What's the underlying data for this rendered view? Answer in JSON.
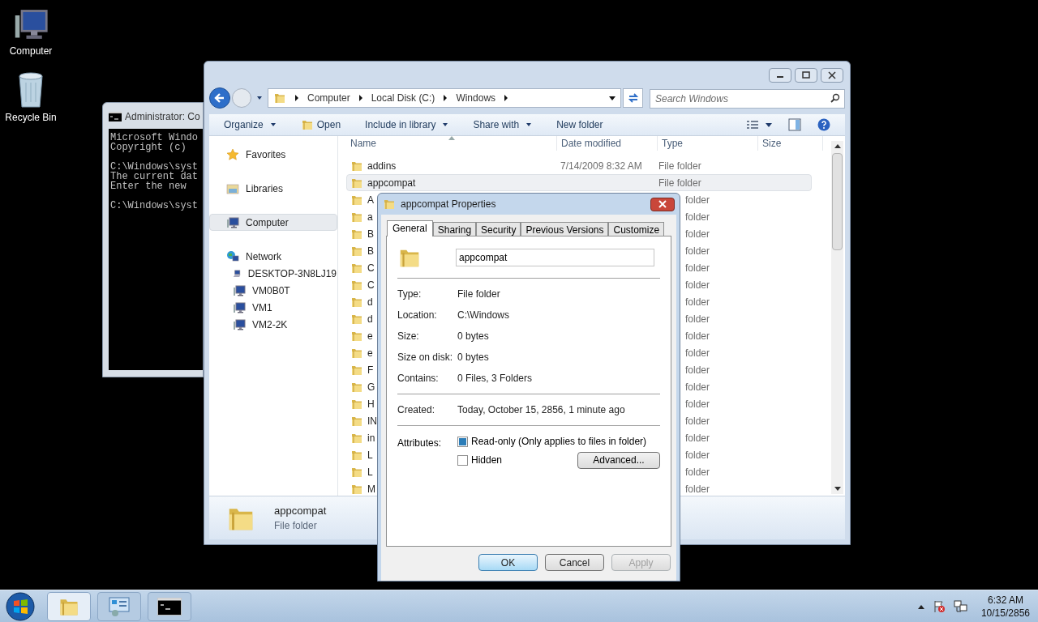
{
  "desktop_icons": [
    {
      "label": "Computer",
      "kind": "computer"
    },
    {
      "label": "Recycle Bin",
      "kind": "recycle"
    }
  ],
  "console": {
    "title": "Administrator: Co",
    "blocks": [
      [
        "Microsoft Windo",
        "Copyright (c)"
      ],
      [
        "C:\\Windows\\syst",
        "The current dat",
        "Enter the new"
      ],
      [
        "C:\\Windows\\syst"
      ]
    ]
  },
  "explorer": {
    "breadcrumbs": [
      "Computer",
      "Local Disk (C:)",
      "Windows"
    ],
    "search": {
      "placeholder": "Search Windows"
    },
    "toolbar": [
      {
        "label": "Organize",
        "kind": "menu"
      },
      {
        "label": "Open",
        "kind": "icon-action"
      },
      {
        "label": "Include in library",
        "kind": "menu"
      },
      {
        "label": "Share with",
        "kind": "menu"
      },
      {
        "label": "New folder",
        "kind": "action"
      }
    ],
    "nav": [
      {
        "label": "Favorites",
        "kind": "star",
        "selected": false
      },
      {
        "label": "Libraries",
        "kind": "library",
        "selected": false
      },
      {
        "label": "Computer",
        "kind": "computer",
        "selected": true
      },
      {
        "label": "Network",
        "kind": "network",
        "selected": false,
        "children": [
          {
            "label": "DESKTOP-3N8LJ19",
            "kind": "pc",
            "selected": false
          },
          {
            "label": "VM0B0T",
            "kind": "computer",
            "selected": false
          },
          {
            "label": "VM1",
            "kind": "computer",
            "selected": false
          },
          {
            "label": "VM2-2K",
            "kind": "computer",
            "selected": false
          }
        ]
      }
    ],
    "columns": [
      "Name",
      "Date modified",
      "Type",
      "Size"
    ],
    "rows": [
      {
        "name": "addins",
        "date": "7/14/2009 8:32 AM",
        "type": "File folder",
        "kind": "full",
        "selected": false
      },
      {
        "name": "appcompat",
        "type": "File folder",
        "kind": "full",
        "selected": true
      },
      {
        "name": "A",
        "type": "folder",
        "kind": "covered",
        "selected": false
      },
      {
        "name": "a",
        "type": "folder",
        "kind": "covered",
        "selected": false
      },
      {
        "name": "B",
        "type": "folder",
        "kind": "covered",
        "selected": false
      },
      {
        "name": "B",
        "type": "folder",
        "kind": "covered",
        "selected": false
      },
      {
        "name": "C",
        "type": "folder",
        "kind": "covered",
        "selected": false
      },
      {
        "name": "C",
        "type": "folder",
        "kind": "covered",
        "selected": false
      },
      {
        "name": "d",
        "type": "folder",
        "kind": "covered",
        "selected": false
      },
      {
        "name": "d",
        "type": "folder",
        "kind": "covered",
        "selected": false
      },
      {
        "name": "e",
        "type": "folder",
        "kind": "covered",
        "selected": false
      },
      {
        "name": "e",
        "type": "folder",
        "kind": "covered",
        "selected": false
      },
      {
        "name": "F",
        "type": "folder",
        "kind": "covered",
        "selected": false
      },
      {
        "name": "G",
        "type": "folder",
        "kind": "covered",
        "selected": false
      },
      {
        "name": "H",
        "type": "folder",
        "kind": "covered",
        "selected": false
      },
      {
        "name": "IN",
        "type": "folder",
        "kind": "covered",
        "selected": false
      },
      {
        "name": "in",
        "type": "folder",
        "kind": "covered",
        "selected": false
      },
      {
        "name": "L",
        "type": "folder",
        "kind": "covered",
        "selected": false
      },
      {
        "name": "L",
        "type": "folder",
        "kind": "covered",
        "selected": false
      },
      {
        "name": "M",
        "type": "folder",
        "kind": "covered",
        "selected": false
      }
    ],
    "details": {
      "name": "appcompat",
      "type": "File folder"
    }
  },
  "dialog": {
    "title": "appcompat Properties",
    "tabs": [
      {
        "label": "General",
        "selected": true
      },
      {
        "label": "Sharing",
        "selected": false
      },
      {
        "label": "Security",
        "selected": false
      },
      {
        "label": "Previous Versions",
        "selected": false
      },
      {
        "label": "Customize",
        "selected": false
      }
    ],
    "name_field": {
      "value": "appcompat"
    },
    "groups": [
      [
        {
          "label": "Type:",
          "value": "File folder"
        },
        {
          "label": "Location:",
          "value": "C:\\Windows"
        },
        {
          "label": "Size:",
          "value": "0 bytes"
        },
        {
          "label": "Size on disk:",
          "value": "0 bytes"
        },
        {
          "label": "Contains:",
          "value": "0 Files, 3 Folders"
        }
      ],
      [
        {
          "label": "Created:",
          "value": "Today, October 15, 2856, 1 minute ago"
        }
      ]
    ],
    "attributes_label": "Attributes:",
    "attributes": [
      {
        "label": "Read-only (Only applies to files in folder)",
        "checked": true
      },
      {
        "label": "Hidden",
        "checked": false
      }
    ],
    "advanced_button": "Advanced...",
    "buttons": [
      {
        "label": "OK",
        "disabled": false,
        "default": true
      },
      {
        "label": "Cancel",
        "disabled": false,
        "default": false
      },
      {
        "label": "Apply",
        "disabled": true,
        "default": false
      }
    ]
  },
  "taskbar": {
    "apps": [
      {
        "kind": "explorer",
        "selected": true
      },
      {
        "kind": "control-panel",
        "selected": false
      },
      {
        "kind": "console",
        "selected": false
      }
    ],
    "time": "6:32 AM",
    "date": "10/15/2856"
  }
}
